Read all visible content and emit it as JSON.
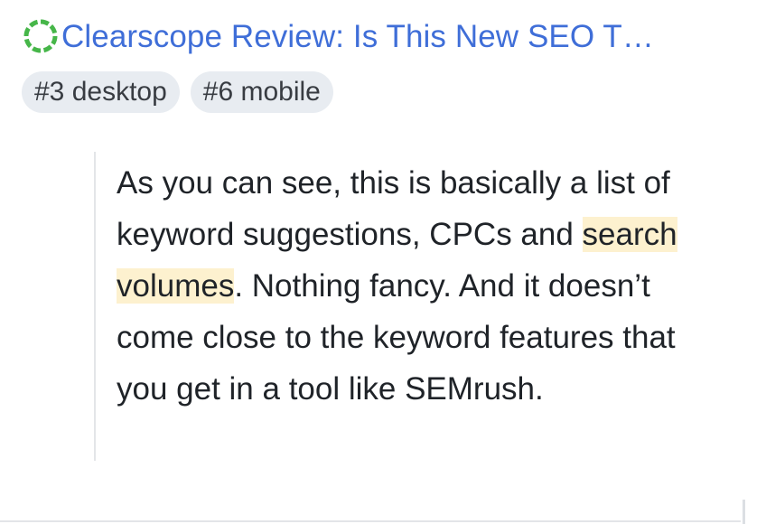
{
  "result": {
    "title": "Clearscope Review: Is This New SEO T…",
    "status_color": "#46b649",
    "title_color": "#3f6ed8",
    "badges": [
      "#3 desktop",
      "#6 mobile"
    ]
  },
  "quote": {
    "segments": [
      "As you can see, this is basically a list of keyword suggestions, CPCs and ",
      "search volumes",
      ". Nothing fancy. And it doesn’t come close to the keyword features that you get in a tool like SEMrush."
    ],
    "highlight_color": "#fdf1cf"
  }
}
